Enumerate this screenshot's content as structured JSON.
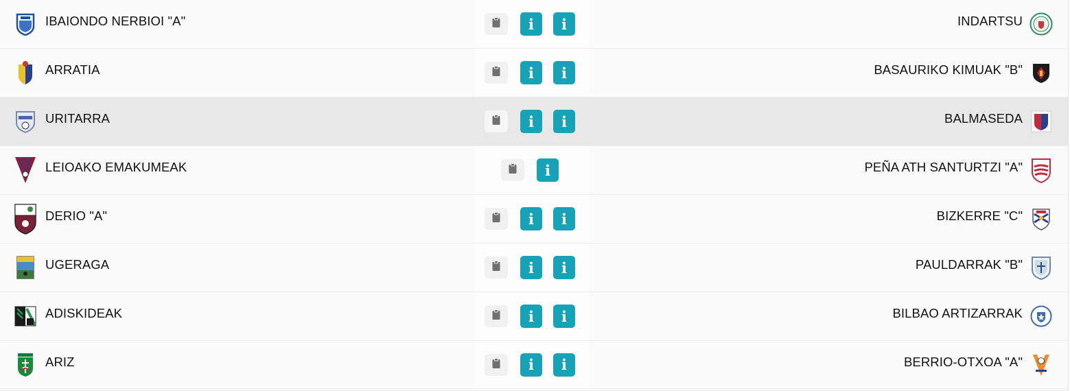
{
  "colors": {
    "info_button": "#17a2b8",
    "clipboard_icon": "#707070",
    "highlight_row": "#e8e8e8"
  },
  "icons": {
    "report": "clipboard-icon",
    "info": "info-icon"
  },
  "info_glyph": "i",
  "matches": [
    {
      "home": "IBAIONDO NERBIOI \"A\"",
      "away": "INDARTSU",
      "highlighted": false,
      "info_buttons": 2
    },
    {
      "home": "ARRATIA",
      "away": "BASAURIKO KIMUAK \"B\"",
      "highlighted": false,
      "info_buttons": 2
    },
    {
      "home": "URITARRA",
      "away": "BALMASEDA",
      "highlighted": true,
      "info_buttons": 2
    },
    {
      "home": "LEIOAKO EMAKUMEAK",
      "away": "PEÑA ATH SANTURTZI \"A\"",
      "highlighted": false,
      "info_buttons": 1
    },
    {
      "home": "DERIO \"A\"",
      "away": "BIZKERRE \"C\"",
      "highlighted": false,
      "info_buttons": 2
    },
    {
      "home": "UGERAGA",
      "away": "PAULDARRAK \"B\"",
      "highlighted": false,
      "info_buttons": 2
    },
    {
      "home": "ADISKIDEAK",
      "away": "BILBAO ARTIZARRAK",
      "highlighted": false,
      "info_buttons": 2
    },
    {
      "home": "ARIZ",
      "away": "BERRIO-OTXOA \"A\"",
      "highlighted": false,
      "info_buttons": 2
    }
  ]
}
